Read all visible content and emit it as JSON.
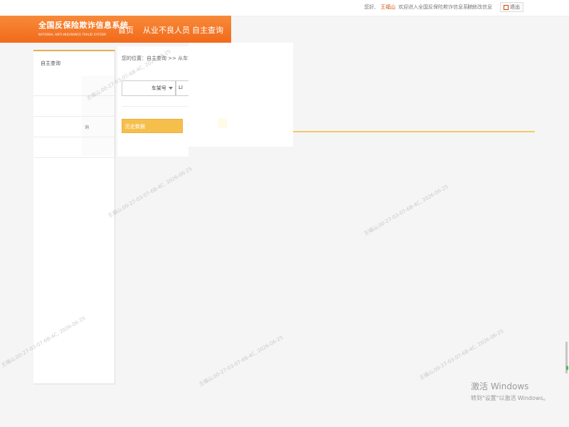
{
  "topbar": {
    "greeting_prefix": "您好,",
    "user_name": "王福山",
    "welcome": "欢迎进入全国反保险欺诈信息系统",
    "separator": "|",
    "misc": "修改信息",
    "logout_label": "退出"
  },
  "header": {
    "title_cn": "全国反保险欺诈信息系统",
    "title_en": "NATIONAL ANTI-INSURANCE FRAUD SYSTEM",
    "nav": [
      {
        "label": "首页"
      },
      {
        "label": "从业不良人员"
      },
      {
        "label": "自主查询"
      }
    ]
  },
  "sidebar": {
    "title": "自主查询",
    "rows": [
      {
        "label": ""
      },
      {
        "label": ""
      },
      {
        "label": "询"
      },
      {
        "label": ""
      }
    ]
  },
  "main": {
    "breadcrumb": "您的位置：自主查询 >> 从车查询",
    "select_value": "车架号",
    "input_value": "LI",
    "history_tab": "历史数据"
  },
  "watermark": {
    "text": "王福山,00-27-03-07-6B-4C, 2026-06-25"
  },
  "windows": {
    "line1": "激活 Windows",
    "line2": "转到\"设置\"以激活 Windows。"
  },
  "colors": {
    "header_orange": "#f26a1b",
    "accent_gold": "#f6bf4c",
    "sidebar_border": "#e5b04c"
  }
}
